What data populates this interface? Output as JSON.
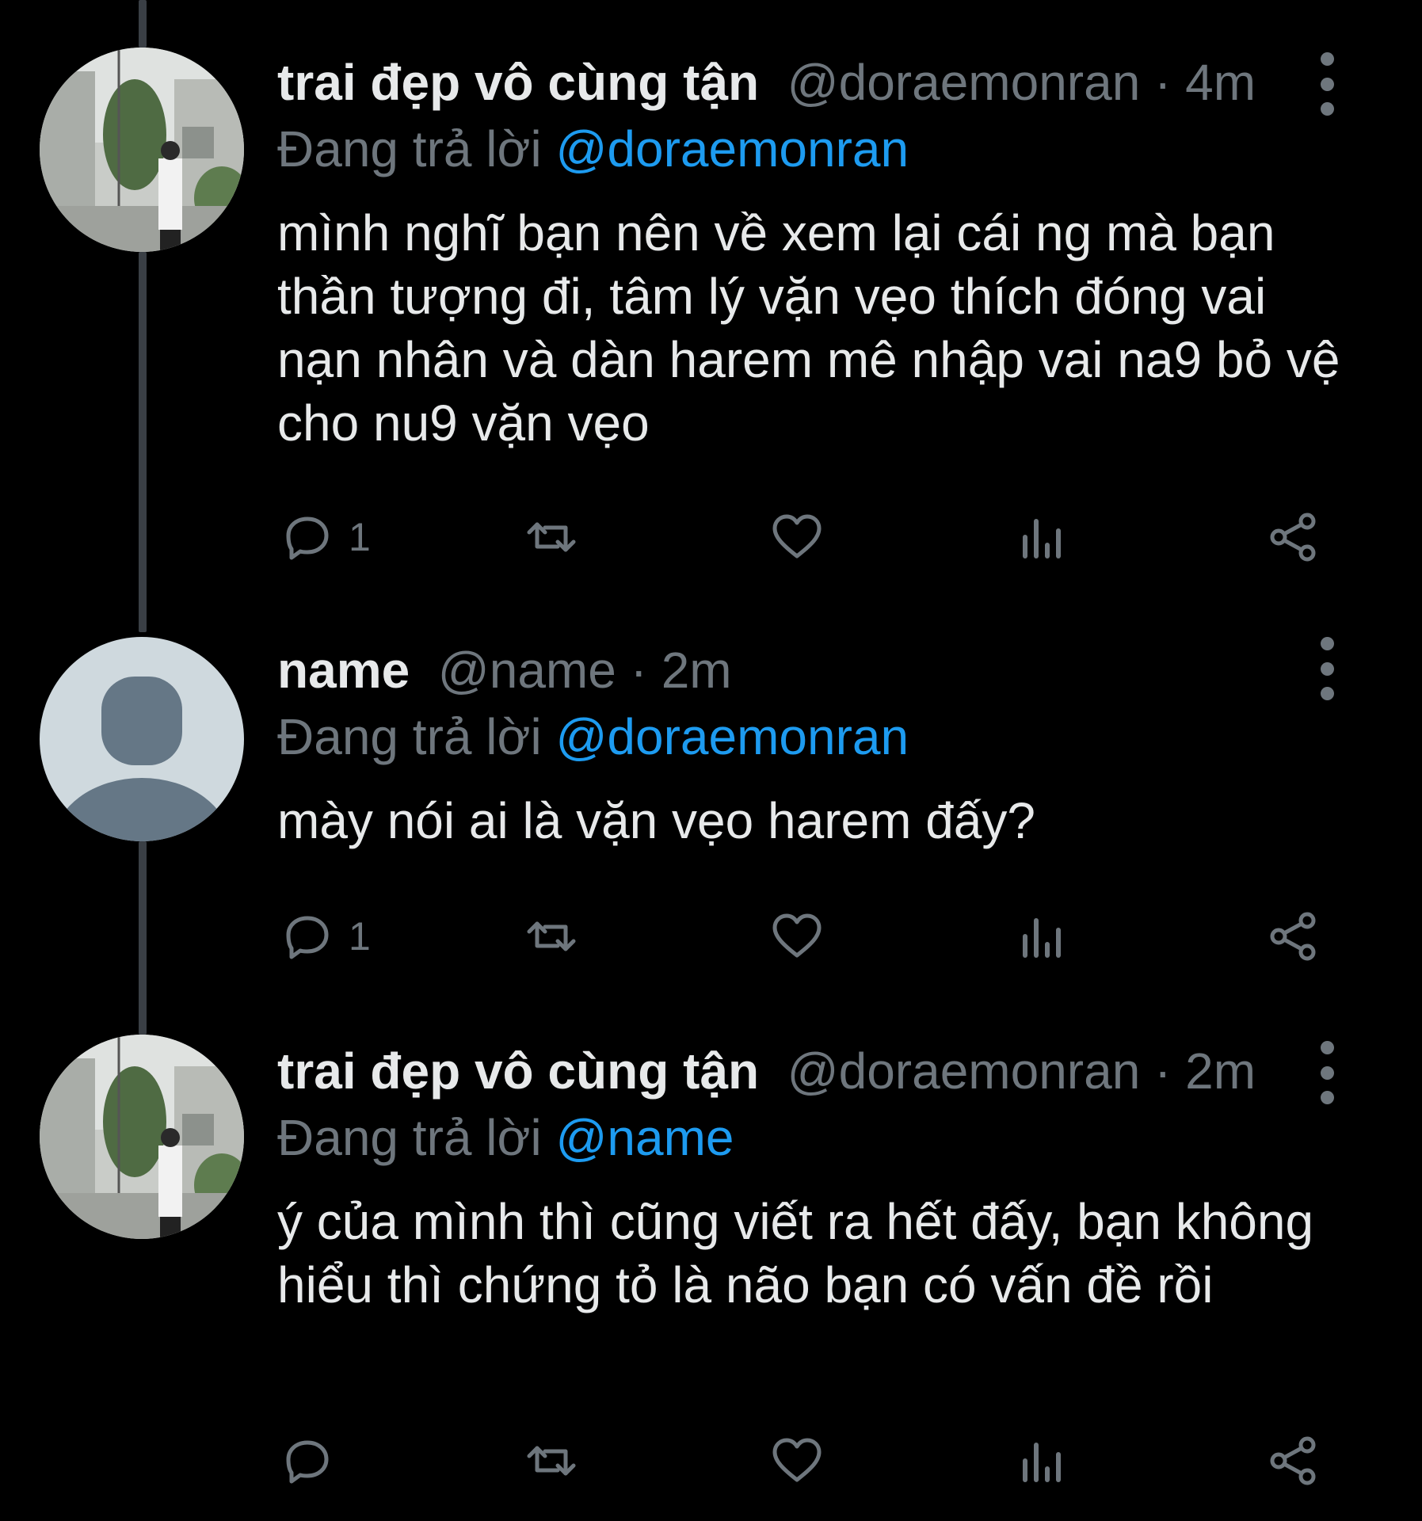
{
  "colors": {
    "background": "#000000",
    "text": "#e7e9ea",
    "secondary": "#6e767d",
    "accent": "#1d9bf0",
    "thread_line": "#3a3f45"
  },
  "tweets": [
    {
      "display_name": "trai đẹp vô cùng tận",
      "handle": "@doraemonran",
      "separator": " · ",
      "time": "4m",
      "replying_to_label": "Đang trả lời ",
      "replying_to": "@doraemonran",
      "text": "mình nghĩ bạn nên về xem lại cái ng mà bạn thần tượng đi, tâm lý vặn vẹo thích đóng vai nạn nhân và dàn harem mê nhập vai na9 bỏ vệ cho nu9 vặn vẹo",
      "reply_count": "1",
      "avatar": "photo-avatar"
    },
    {
      "display_name": "name",
      "handle": "@name",
      "separator": " · ",
      "time": "2m",
      "replying_to_label": "Đang trả lời ",
      "replying_to": "@doraemonran",
      "text": "mày nói ai là vặn vẹo harem đấy?",
      "reply_count": "1",
      "avatar": "default-avatar"
    },
    {
      "display_name": "trai đẹp vô cùng tận",
      "handle": "@doraemonran",
      "separator": " · ",
      "time": "2m",
      "replying_to_label": "Đang trả lời ",
      "replying_to": "@name",
      "text": "ý của mình thì cũng viết ra hết đấy, bạn không hiểu thì chứng tỏ là não bạn có vấn đề rồi",
      "reply_count": "",
      "avatar": "photo-avatar"
    }
  ],
  "icons": [
    "reply-icon",
    "retweet-icon",
    "like-icon",
    "analytics-icon",
    "share-icon",
    "more-options-icon"
  ]
}
